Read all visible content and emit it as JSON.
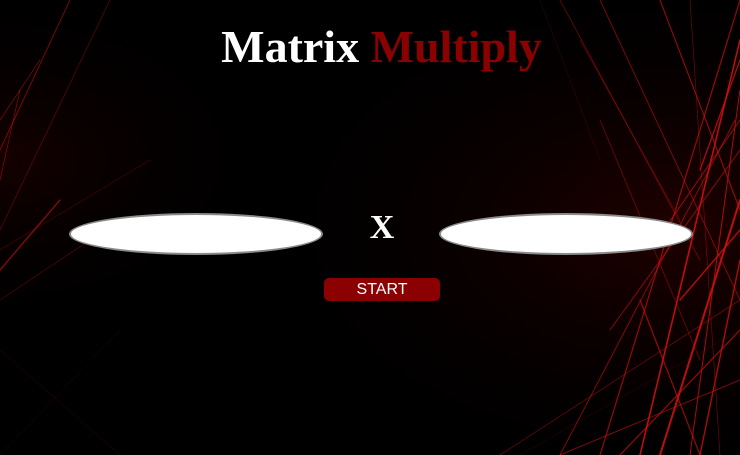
{
  "title": {
    "part1": "Matrix",
    "part2": "Multiply"
  },
  "inputs": {
    "left_value": "",
    "right_value": ""
  },
  "operator": "X",
  "start_button": {
    "label": "START"
  },
  "colors": {
    "background": "#000000",
    "accent": "#8b0000",
    "text": "#ffffff"
  }
}
